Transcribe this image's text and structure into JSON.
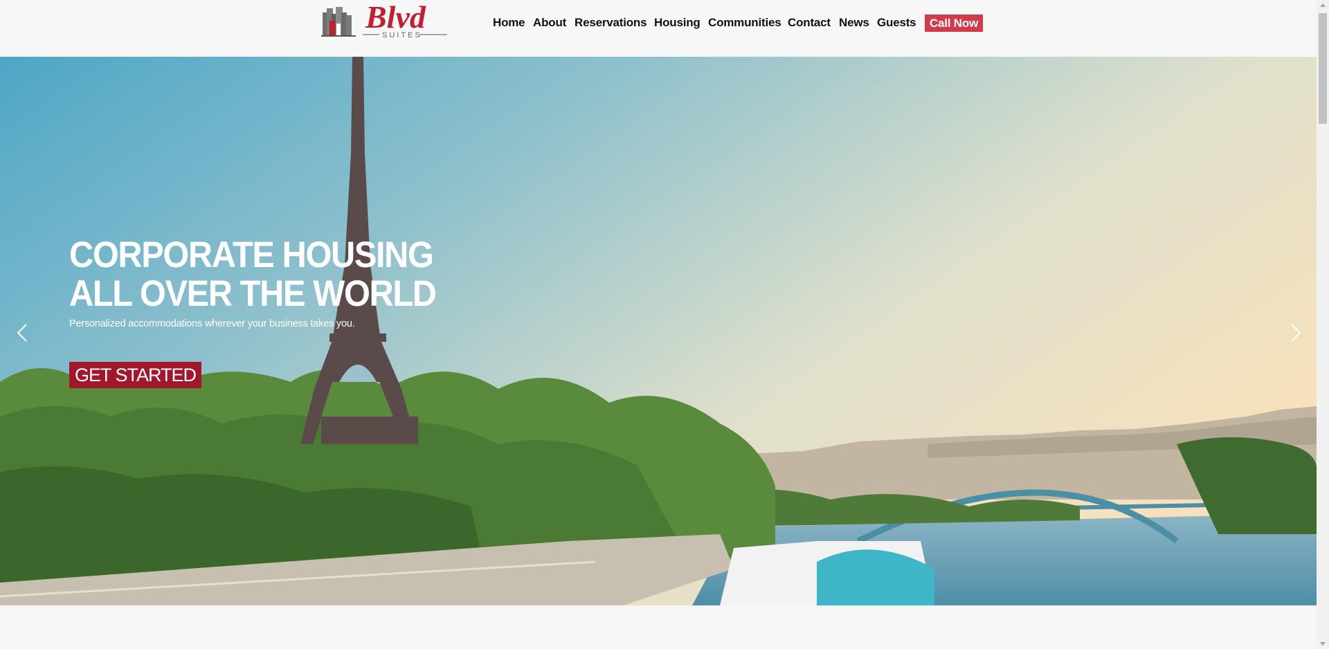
{
  "brand": {
    "logo_text": "Blvd",
    "logo_subtext": "SUITES"
  },
  "nav": {
    "items": [
      "Home",
      "About",
      "Reservations",
      "Housing",
      "Communities",
      "Contact",
      "News",
      "Guests"
    ],
    "cta": "Call Now"
  },
  "hero": {
    "headline_line1": "CORPORATE HOUSING",
    "headline_line2": "ALL OVER THE WORLD",
    "subtext": "Personalized accommodations wherever your business takes you.",
    "button": "GET STARTED",
    "prev_icon": "chevron-left-icon",
    "next_icon": "chevron-right-icon"
  },
  "colors": {
    "brand_red": "#c3202f",
    "cta_red": "#d33a4a",
    "button_red": "#a3172c"
  }
}
